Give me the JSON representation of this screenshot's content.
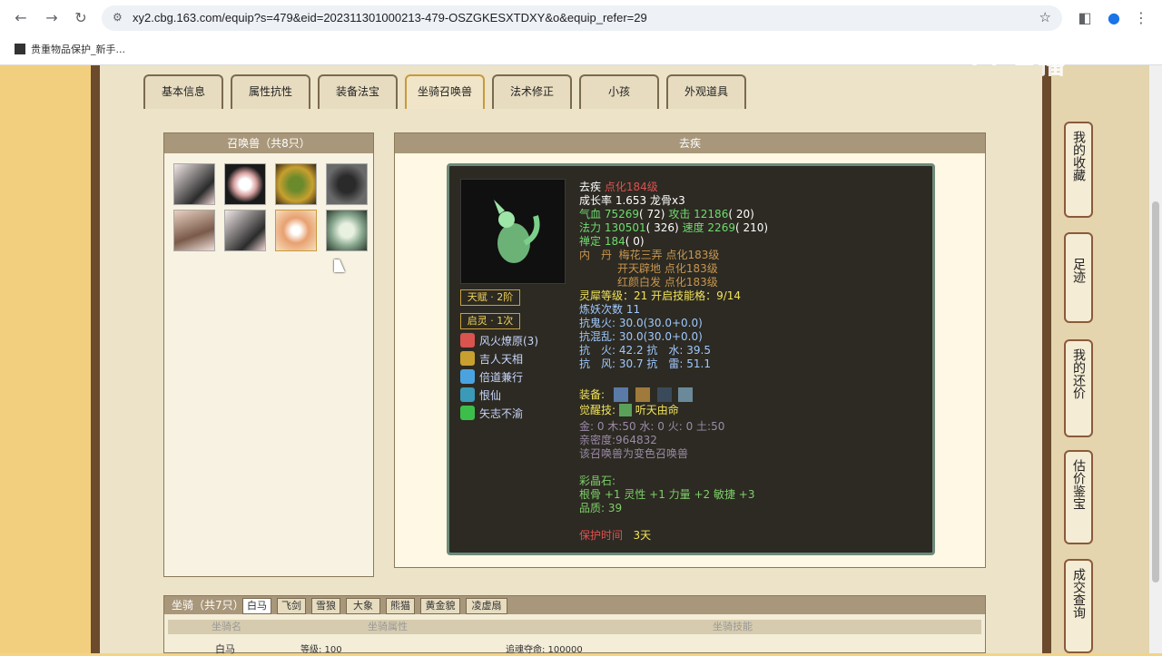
{
  "browser": {
    "url": "xy2.cbg.163.com/equip?s=479&eid=202311301000213-479-OSZGKESXTDXY&o&equip_refer=29",
    "bookmark": "贵重物品保护_新手..."
  },
  "watermark": "CC直播",
  "tabs": [
    "基本信息",
    "属性抗性",
    "装备法宝",
    "坐骑召唤兽",
    "法术修正",
    "小孩",
    "外观道具"
  ],
  "active_tab": "坐骑召唤兽",
  "pet_list": {
    "header": "召唤兽（共8只）"
  },
  "detail": {
    "header": "去疾",
    "name": "去疾",
    "name_level": "点化184级",
    "growth": "成长率 1.653 龙骨x3",
    "hp_label": "气血",
    "hp_value": "75269",
    "hp_extra": "( 72)",
    "atk_label": "攻击",
    "atk_value": "12186",
    "atk_extra": "( 20)",
    "mp_label": "法力",
    "mp_value": "130501",
    "mp_extra": "( 326)",
    "spd_label": "速度",
    "spd_value": "2269",
    "spd_extra": "( 210)",
    "zen_label": "禅定",
    "zen_value": "184",
    "zen_extra": "( 0)",
    "neidan_label": "内　丹",
    "neidan_1": "梅花三弄 点化183级",
    "neidan_2": "开天辟地 点化183级",
    "neidan_3": "红颜白发 点化183级",
    "lingxi_label": "灵犀等级：",
    "lingxi_value": "21 开启技能格：",
    "lingxi_value2": "9/14",
    "lianyao": "炼妖次数 11",
    "kang1": "抗鬼火: 30.0(30.0+0.0)",
    "kang2": "抗混乱: 30.0(30.0+0.0)",
    "kang3": "抗　火: 42.2 抗　水: 39.5",
    "kang4": "抗　风: 30.7 抗　雷: 51.1",
    "equip_label": "装备:",
    "awaken_label": "觉醒技:",
    "awaken_value": "听天由命",
    "elements": "金: 0 木:50 水: 0 火: 0 土:50",
    "intimacy": "亲密度:964832",
    "variant": "该召唤兽为变色召唤兽",
    "gem_label": "彩晶石:",
    "gem_value": "根骨 +1 灵性 +1 力量 +2 敏捷 +3",
    "quality": "品质: 39",
    "protect_label": "保护时间",
    "protect_value": "3天",
    "talent": "天赋 · 2阶",
    "qiling": "启灵 · 1次",
    "skills": [
      "风火燎原(3)",
      "吉人天相",
      "倍道兼行",
      "恨仙",
      "矢志不渝"
    ],
    "skill_colors": [
      "#d9534f",
      "#c8a030",
      "#4aa3df",
      "#3a9ab8",
      "#3cbf4a"
    ]
  },
  "mounts": {
    "header": "坐骑（共7只）",
    "tabs": [
      "白马",
      "飞剑",
      "雪狼",
      "大象",
      "熊猫",
      "黄金貌",
      "凌虚扇"
    ],
    "active_tab": "白马",
    "columns": [
      "坐骑名",
      "坐骑属性",
      "坐骑技能"
    ],
    "row": {
      "name": "白马",
      "attr": "等级: 100",
      "skill": "追魂夺命: 100000"
    }
  },
  "side_buttons": [
    "我的收藏",
    "足迹",
    "我的还价",
    "估价鉴宝",
    "成交查询"
  ]
}
